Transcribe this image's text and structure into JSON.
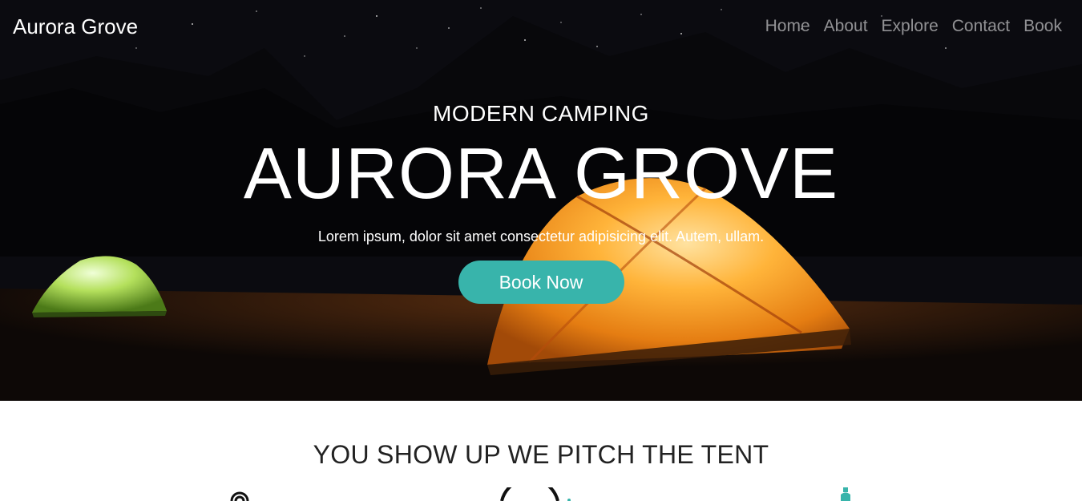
{
  "navbar": {
    "brand": "Aurora Grove",
    "links": [
      "Home",
      "About",
      "Explore",
      "Contact",
      "Book"
    ]
  },
  "hero": {
    "kicker": "MODERN CAMPING",
    "title": "AURORA GROVE",
    "description": "Lorem ipsum, dolor sit amet consectetur adipisicing elit. Autem, ullam.",
    "cta_label": "Book Now"
  },
  "section": {
    "title": "YOU SHOW UP WE PITCH THE TENT"
  },
  "icons": [
    "spiral-icon",
    "circle-icon",
    "bottle-icon"
  ],
  "colors": {
    "accent": "#38b4ab",
    "nav_link": "#9a9a9a",
    "tent_orange": "#f5a020",
    "tent_green": "#b6e060"
  }
}
